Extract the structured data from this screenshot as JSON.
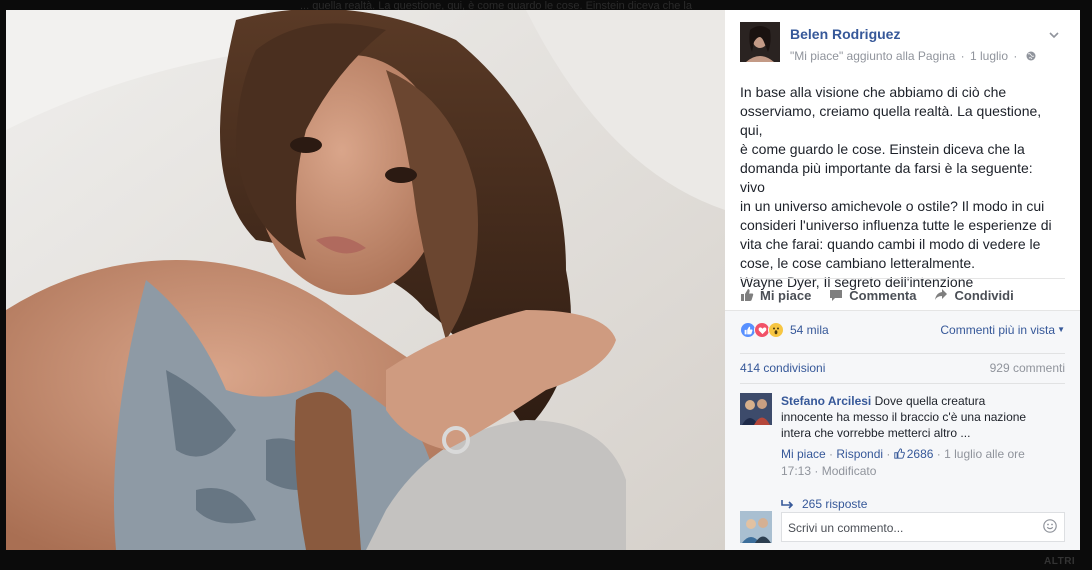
{
  "post": {
    "author": "Belen Rodriguez",
    "subtitle": "\"Mi piace\" aggiunto alla Pagina",
    "date": "1 luglio",
    "body": "In base alla visione che abbiamo di ciò che\nosserviamo, creiamo quella realtà. La questione, qui,\nè come guardo le cose. Einstein diceva che la\ndomanda più importante da farsi è la seguente: vivo\nin un universo amichevole o ostile? Il modo in cui\nconsideri l'universo influenza tutte le esperienze di\nvita che farai: quando cambi il modo di vedere le\ncose, le cose cambiano letteralmente.\nWayne Dyer, Il segreto dell'intenzione"
  },
  "actions": {
    "like": "Mi piace",
    "comment": "Commenta",
    "share": "Condividi"
  },
  "stats": {
    "reactions_count": "54 mila",
    "order_label": "Commenti più in vista",
    "shares": "414 condivisioni",
    "comments": "929 commenti"
  },
  "comment": {
    "author": "Stefano Arcilesi",
    "text": " Dove quella creatura innocente ha messo il braccio c'è una nazione intera che vorrebbe metterci altro ...",
    "like": "Mi piace",
    "reply": "Rispondi",
    "likes": "2686",
    "time": "1 luglio alle ore 17:13",
    "edited": "Modificato",
    "replies": "265 risposte"
  },
  "composer": {
    "placeholder": "Scrivi un commento..."
  },
  "page": {
    "altri_label": "ALTRI",
    "top_caption": "... quella realtà. La questione, qui, è come guardo le cose. Einstein diceva che la"
  },
  "colors": {
    "link": "#365899",
    "muted": "#90949c",
    "background": "#0b0b0b"
  },
  "icons": [
    "globe-icon",
    "chevron-down-icon",
    "like-icon",
    "comment-icon",
    "share-icon",
    "reply-arrow-icon",
    "smiley-icon",
    "love-reaction-icon",
    "wow-reaction-icon"
  ]
}
